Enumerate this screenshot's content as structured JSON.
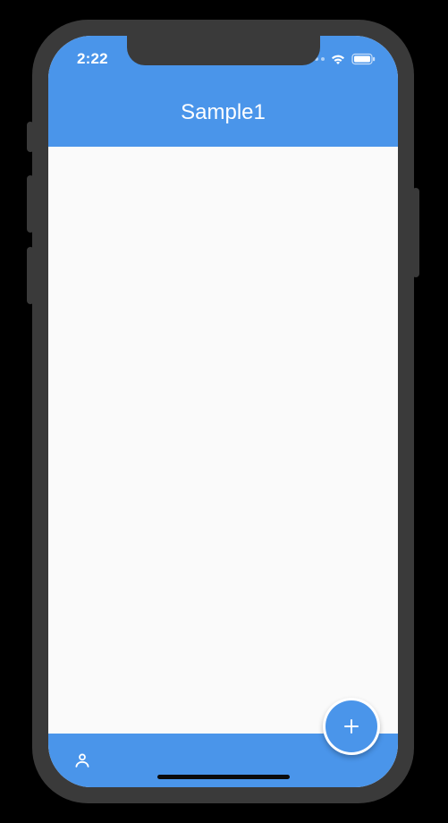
{
  "status": {
    "time": "2:22"
  },
  "appbar": {
    "title": "Sample1"
  },
  "colors": {
    "primary": "#4a95ea",
    "surface": "#fafafa",
    "frame": "#3a3a3a"
  },
  "icons": {
    "wifi": "wifi-icon",
    "battery": "battery-icon",
    "cell": "cell-dots-icon",
    "person": "person-icon",
    "plus": "plus-icon"
  }
}
